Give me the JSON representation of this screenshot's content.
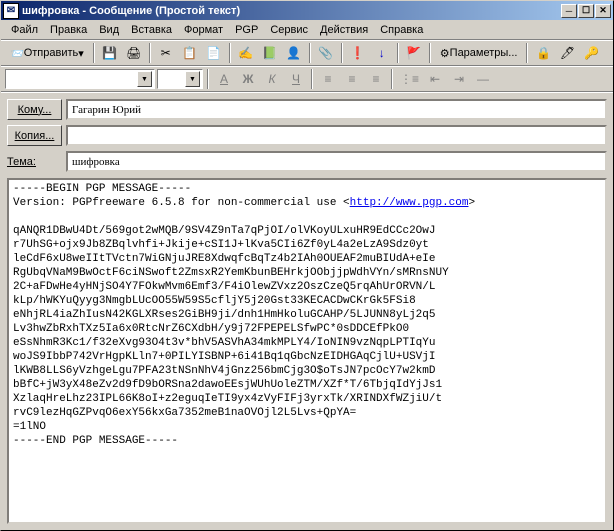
{
  "window": {
    "title": "шифровка - Сообщение (Простой текст)"
  },
  "menu": {
    "file": "Файл",
    "edit": "Правка",
    "view": "Вид",
    "insert": "Вставка",
    "format": "Формат",
    "pgp": "PGP",
    "service": "Сервис",
    "actions": "Действия",
    "help": "Справка"
  },
  "toolbar": {
    "send": "Отправить",
    "params": "Параметры..."
  },
  "fields": {
    "to_label": "Кому...",
    "to_value": "Гагарин Юрий",
    "cc_label": "Копия...",
    "cc_value": "",
    "subject_label": "Тема:",
    "subject_value": "шифровка"
  },
  "body": {
    "header": "-----BEGIN PGP MESSAGE-----",
    "version": "Version: PGPfreeware 6.5.8 for non-commercial use <",
    "link": "http://www.pgp.com",
    "close": ">",
    "lines": [
      "qANQR1DBwU4Dt/569got2wMQB/9SV4Z9nTa7qPjOI/olVKoyULxuHR9EdCCc2OwJ",
      "r7UhSG+ojx9Jb8ZBqlvhfi+Jkije+cSI1J+lKva5CIi6Zf0yL4a2eLzA9Sdz0yt",
      "leCdF6xU8weIItTVctn7WiGNjuJRE8XdwqfcBqTz4b2IAh0OUEAF2muBIUdA+eIe",
      "RgUbqVNaM9BwOctF6ciNSwoft2ZmsxR2YemKbunBEHrkjOObjjpWdhVYn/sMRnsNUY",
      "2C+aFDwHe4yHNjSO4Y7FOkwMvm6Emf3/F4iOlewZVxz2OszCzeQ5rqAhUrORVN/L",
      "kLp/hWKYuQyyg3NmgbLUcOO55W59S5cfljY5j20Gst33KECACDwCKrGk5FSi8",
      "eNhjRL4iaZhIusN42KGLXRses2GiBH9ji/dnh1HmHkoluGCAHP/5LJUNN8yLj2q5",
      "Lv3hwZbRxhTXz5Ia6x0RtcNrZ6CXdbH/y9j72FPEPELSfwPC*0sDDCEfPkO0",
      "eSsNhmR3Kc1/f32eXvg93O4t3v*bhV5ASVhA34mkMPLY4/IoNIN9vzNqpLPTIqYu",
      "woJS9IbbP742VrHgpKLln7+0PILYISBNP+6i41Bq1qGbcNzEIDHGAqCjlU+USVjI",
      "lKWB8LLS6yVzhgeLgu7PFA23tNSnNhV4jGnz256bmCjg3O$oTsJN7pcOcY7w2kmD",
      "bBfC+jW3yX48eZv2d9fD9bORSna2dawoEEsjWUhUoleZTM/XZf*T/6TbjqIdYjJs1",
      "XzlaqHreLhz23IPL66K8oI+z2eguqIeTI9yx4zVyFIFj3yrxTk/XRINDXfWZjiU/t",
      "rvC9lezHqGZPvqO6exY56kxGa7352meB1naOVOjl2L5Lvs+QpYA=",
      "=1lNO"
    ],
    "footer": "-----END PGP MESSAGE-----"
  }
}
